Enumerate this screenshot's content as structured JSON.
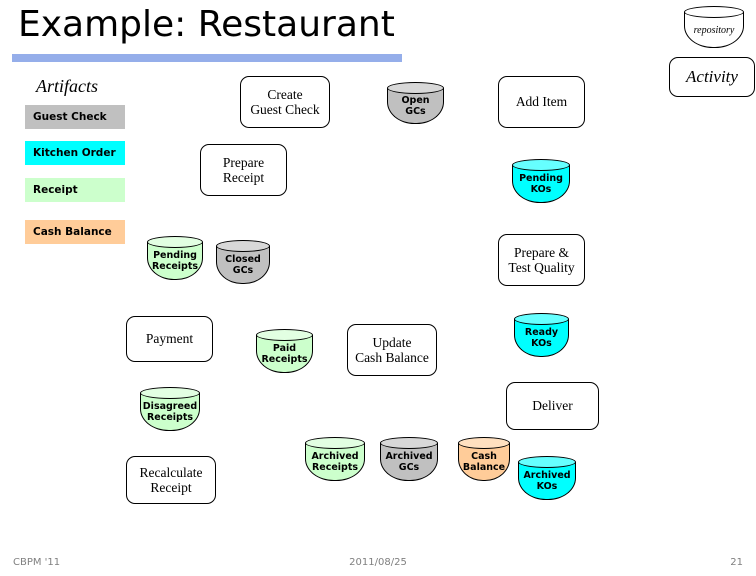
{
  "slide": {
    "title": "Example: Restaurant",
    "accent_color": "#95aeea",
    "background": "#ffffff"
  },
  "legend": {
    "artifacts_heading": "Artifacts",
    "artifacts": [
      {
        "label": "Guest Check",
        "color": "#c0c0c0"
      },
      {
        "label": "Kitchen Order",
        "color": "#00ffff"
      },
      {
        "label": "Receipt",
        "color": "#ccffcc"
      },
      {
        "label": "Cash Balance",
        "color": "#ffcc99"
      }
    ],
    "repository_label": "repository",
    "activity_label": "Activity"
  },
  "activities": [
    {
      "id": "create-guest-check",
      "label": "Create\nGuest Check"
    },
    {
      "id": "add-item",
      "label": "Add Item"
    },
    {
      "id": "prepare-receipt",
      "label": "Prepare\nReceipt"
    },
    {
      "id": "prepare-test-quality",
      "label": "Prepare &\nTest Quality"
    },
    {
      "id": "payment",
      "label": "Payment"
    },
    {
      "id": "update-cash-balance",
      "label": "Update\nCash Balance"
    },
    {
      "id": "deliver",
      "label": "Deliver"
    },
    {
      "id": "recalculate-receipt",
      "label": "Recalculate\nReceipt"
    }
  ],
  "repositories": [
    {
      "id": "open-gcs",
      "label": "Open\nGCs",
      "color": "#c0c0c0"
    },
    {
      "id": "pending-kos",
      "label": "Pending\nKOs",
      "color": "#00ffff"
    },
    {
      "id": "pending-receipts",
      "label": "Pending\nReceipts",
      "color": "#ccffcc"
    },
    {
      "id": "closed-gcs",
      "label": "Closed\nGCs",
      "color": "#c0c0c0"
    },
    {
      "id": "ready-kos",
      "label": "Ready\nKOs",
      "color": "#00ffff"
    },
    {
      "id": "paid-receipts",
      "label": "Paid\nReceipts",
      "color": "#ccffcc"
    },
    {
      "id": "disagreed-receipts",
      "label": "Disagreed\nReceipts",
      "color": "#ccffcc"
    },
    {
      "id": "archived-receipts",
      "label": "Archived\nReceipts",
      "color": "#ccffcc"
    },
    {
      "id": "archived-gcs",
      "label": "Archived\nGCs",
      "color": "#c0c0c0"
    },
    {
      "id": "cash-balance",
      "label": "Cash\nBalance",
      "color": "#ffcc99"
    },
    {
      "id": "archived-kos",
      "label": "Archived\nKOs",
      "color": "#00ffff"
    }
  ],
  "footer": {
    "left": "CBPM '11",
    "center": "2011/08/25",
    "right": "21"
  }
}
